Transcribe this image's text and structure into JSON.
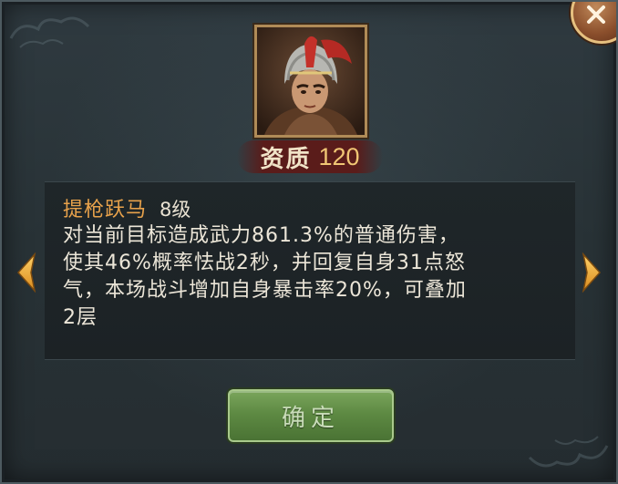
{
  "aptitude": {
    "label": "资质",
    "value": "120"
  },
  "skill": {
    "name": "提枪跃马",
    "level": "8级",
    "description": [
      "对当前目标造成武力861.3%的普通伤害，",
      "使其46%概率怯战2秒，并回复自身31点怒",
      "气，本场战斗增加自身暴击率20%，可叠加",
      "2层"
    ]
  },
  "buttons": {
    "confirm_label": "确定"
  },
  "icons": {
    "close": "close-icon",
    "prev": "arrow-left-icon",
    "next": "arrow-right-icon",
    "portrait": "general-portrait"
  },
  "colors": {
    "skill_name": "#e8a24b",
    "aptitude_value": "#f0c674",
    "confirm_button": "#5e8a43",
    "panel_background": "#283236"
  }
}
